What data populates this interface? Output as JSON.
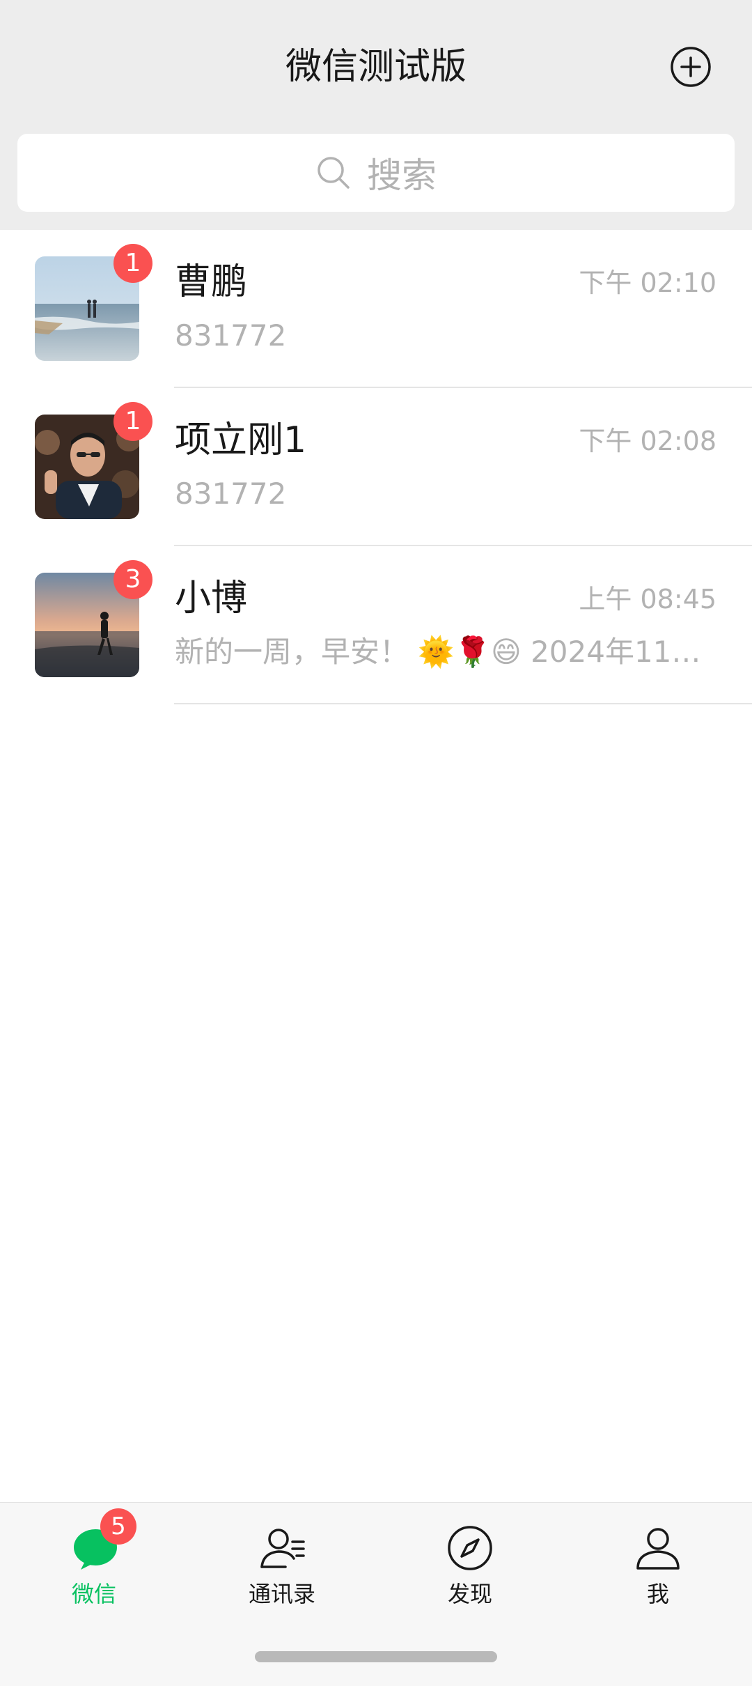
{
  "header": {
    "title": "微信测试版",
    "add_icon": "plus-circle-icon"
  },
  "search": {
    "placeholder": "搜索",
    "icon": "search-icon"
  },
  "chats": [
    {
      "name": "曹鹏",
      "time": "下午 02:10",
      "preview": "831772",
      "unread": "1"
    },
    {
      "name": "项立刚1",
      "time": "下午 02:08",
      "preview": "831772",
      "unread": "1"
    },
    {
      "name": "小博",
      "time": "上午 08:45",
      "preview": "新的一周，早安！ 🌞🌹😄 2024年11…",
      "unread": "3"
    }
  ],
  "tabbar": {
    "items": [
      {
        "label": "微信",
        "icon": "chat-bubbles-icon",
        "badge": "5",
        "active": true
      },
      {
        "label": "通讯录",
        "icon": "contacts-icon",
        "active": false
      },
      {
        "label": "发现",
        "icon": "compass-icon",
        "active": false
      },
      {
        "label": "我",
        "icon": "person-icon",
        "active": false
      }
    ]
  },
  "colors": {
    "accent": "#07c160",
    "badge": "#fa5151",
    "header_bg": "#ededed",
    "secondary_text": "#b2b2b2"
  }
}
